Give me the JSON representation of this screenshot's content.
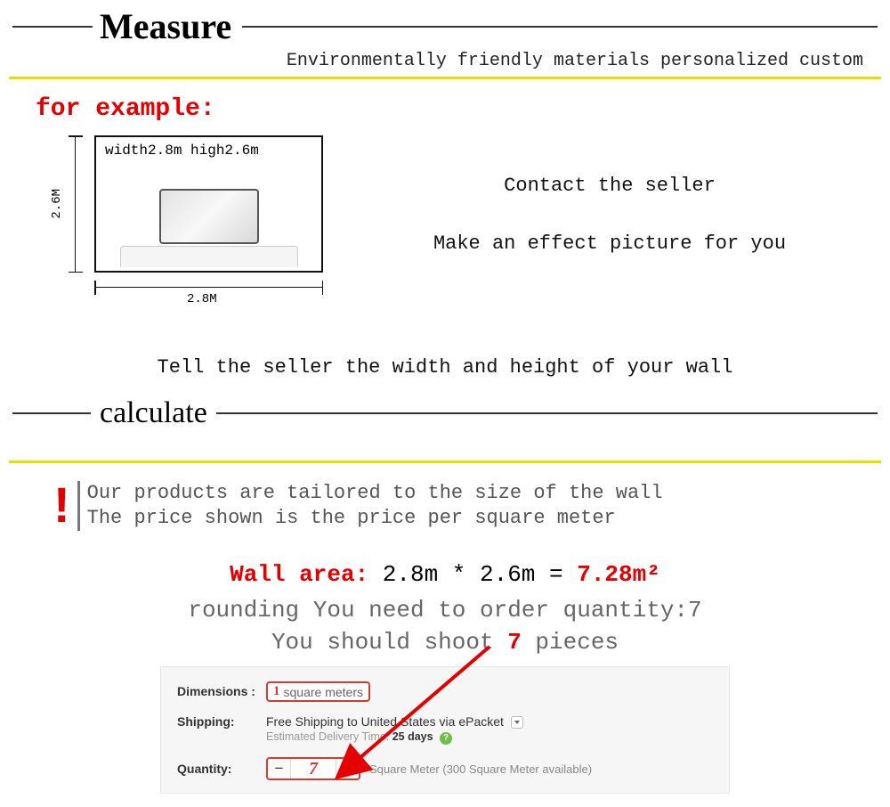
{
  "header": {
    "title": "Measure",
    "subtitle": "Environmentally friendly materials personalized custom"
  },
  "example": {
    "label": "for example:",
    "box_label": "width2.8m  high2.6m",
    "dim_v": "2.6M",
    "dim_h": "2.8M",
    "right_line1": "Contact the seller",
    "right_line2": "Make an effect picture for you",
    "tell": "Tell the seller the width and height of your wall"
  },
  "calc": {
    "title": "calculate",
    "warn_line1": "Our products are tailored to the size of the wall",
    "warn_line2": "The price shown is the price per square meter",
    "area_label": "Wall area:",
    "area_expr": " 2.8m * 2.6m = ",
    "area_result": "7.28m²",
    "round_text": "rounding   You need to order quantity:7",
    "shoot_pre": "You should shoot ",
    "shoot_qty": "7",
    "shoot_post": " pieces"
  },
  "panel": {
    "dimensions_label": "Dimensions :",
    "dim_value_prefix": "1",
    "dim_value_text": "square meters",
    "shipping_label": "Shipping:",
    "shipping_text": "Free Shipping to United States via ePacket",
    "shipping_sub_pre": "Estimated Delivery Time: ",
    "shipping_sub_days": "25 days",
    "quantity_label": "Quantity:",
    "qty_minus": "−",
    "qty_value": "7",
    "qty_plus": "+",
    "qty_note": "Square Meter (300 Square Meter available)"
  }
}
